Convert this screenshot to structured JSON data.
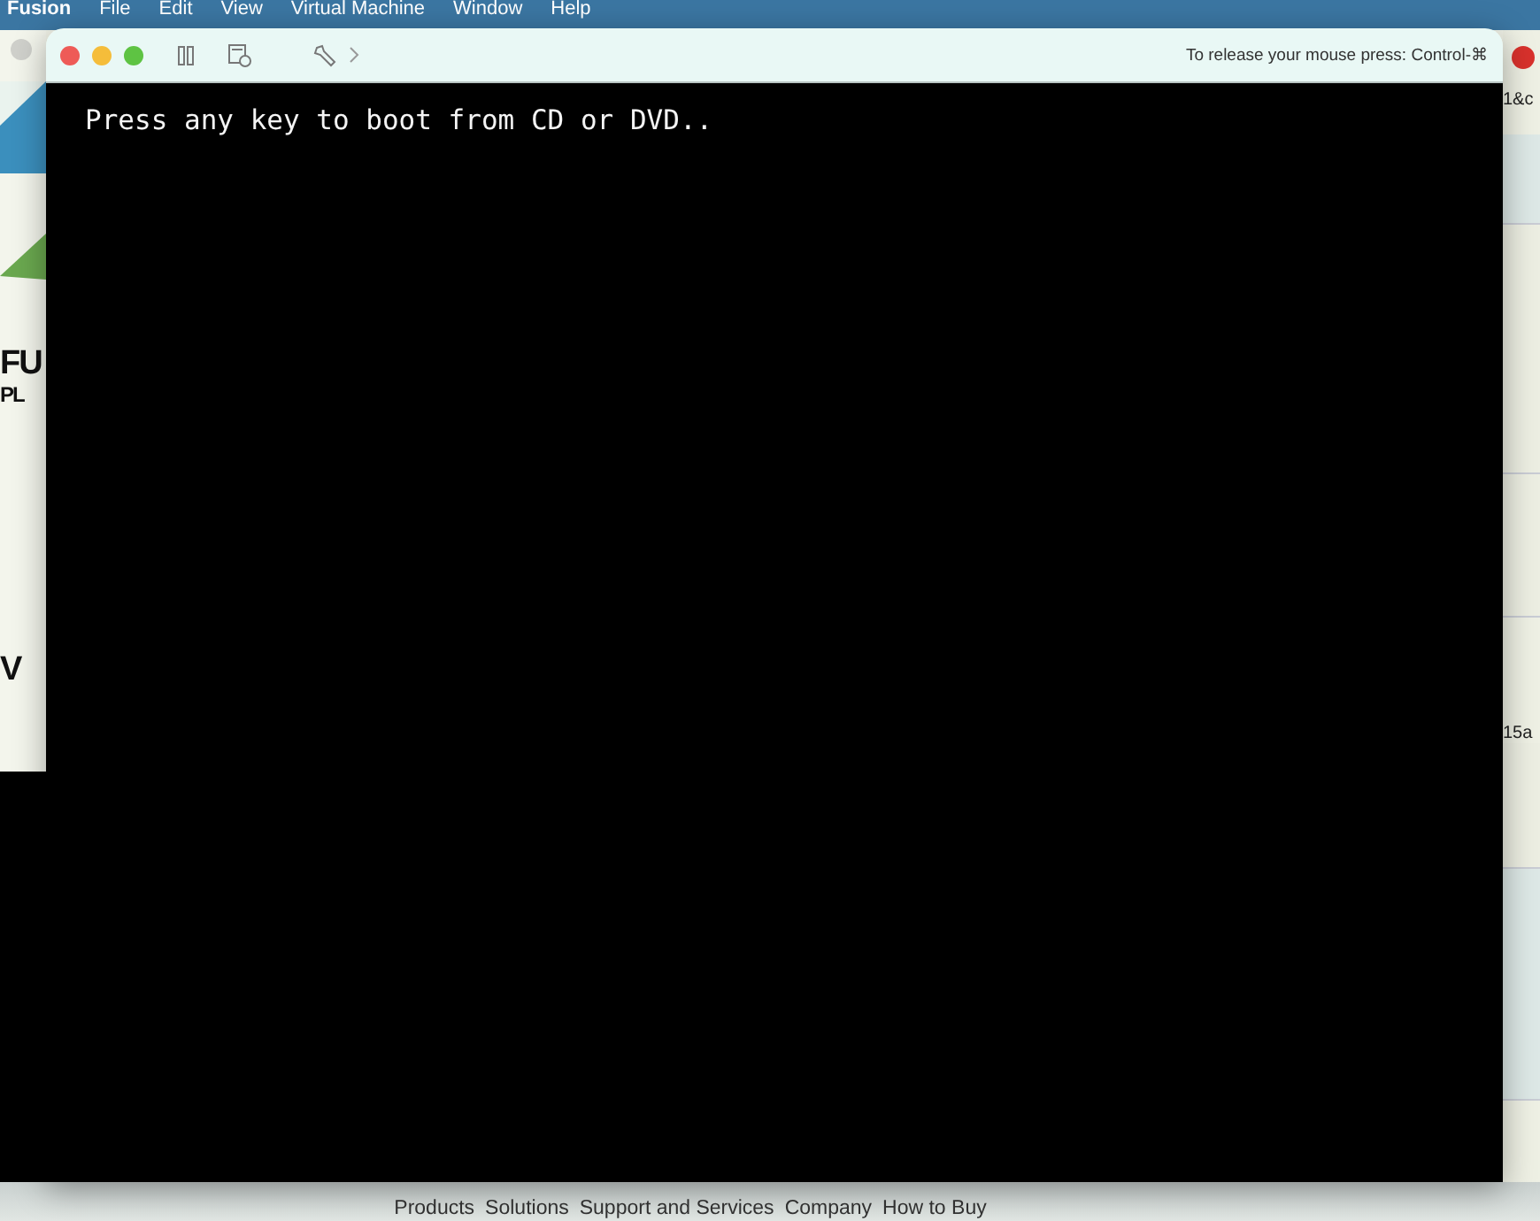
{
  "menu_bar": {
    "items": [
      {
        "label": "Fusion",
        "kind": "app"
      },
      {
        "label": "File",
        "kind": "menu"
      },
      {
        "label": "Edit",
        "kind": "menu"
      },
      {
        "label": "View",
        "kind": "menu"
      },
      {
        "label": "Virtual Machine",
        "kind": "menu"
      },
      {
        "label": "Window",
        "kind": "menu"
      },
      {
        "label": "Help",
        "kind": "menu"
      }
    ]
  },
  "background_page": {
    "left_texts": [
      {
        "label": "FU",
        "kind": "heading"
      },
      {
        "label": "PL",
        "kind": "subheading"
      },
      {
        "label": "V",
        "kind": "heading"
      }
    ],
    "right_texts": [
      "1&c",
      "15a"
    ],
    "footer_links": [
      "Products",
      "Solutions",
      "Support and Services",
      "Company",
      "How to Buy"
    ]
  },
  "vm_window": {
    "release_hint": "To release your mouse press: Control-⌘",
    "console_text": "Press any key to boot from CD or DVD.."
  }
}
